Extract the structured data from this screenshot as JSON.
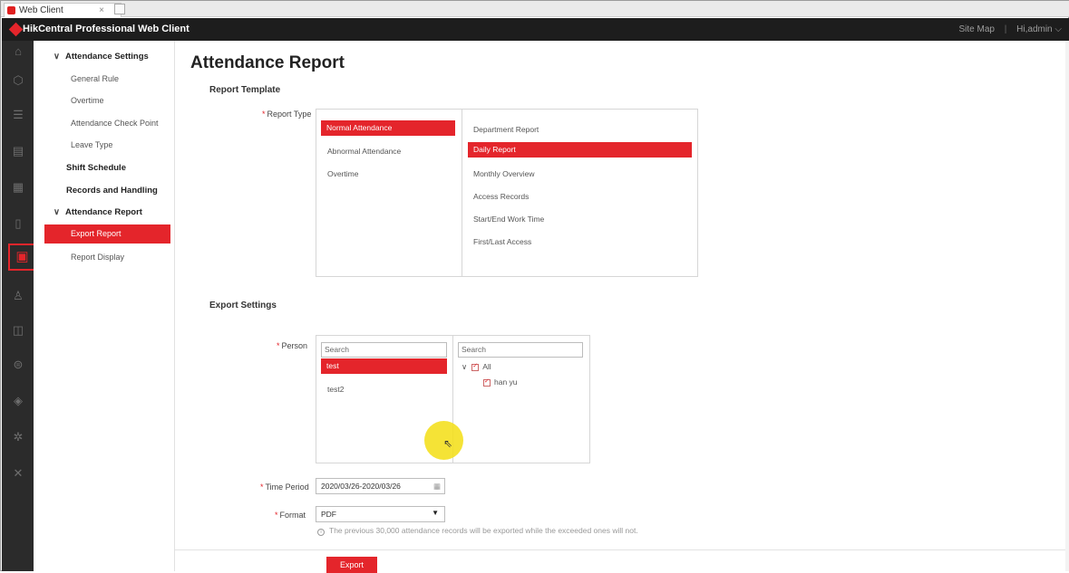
{
  "browser": {
    "tab_title": "Web Client",
    "close_glyph": "×"
  },
  "app": {
    "name": "HikCentral Professional Web Client",
    "site_map": "Site Map",
    "separator": "|",
    "user": "Hi,admin"
  },
  "rail_icons": [
    "home-icon",
    "cube-icon",
    "list-icon",
    "document-icon",
    "report-icon",
    "mobile-icon",
    "calendar-check-icon",
    "person-icon",
    "chart-icon",
    "vehicle-icon",
    "shield-icon",
    "settings-icon",
    "tools-icon"
  ],
  "nav": {
    "attendance_settings": "Attendance Settings",
    "general_rule": "General Rule",
    "overtime": "Overtime",
    "check_point": "Attendance Check Point",
    "leave_type": "Leave Type",
    "shift_schedule": "Shift Schedule",
    "records": "Records and Handling",
    "attendance_report": "Attendance Report",
    "export_report": "Export Report",
    "report_display": "Report Display"
  },
  "page": {
    "title": "Attendance Report",
    "report_template": "Report Template",
    "export_settings": "Export Settings"
  },
  "report_type": {
    "label": "Report Type",
    "left": [
      "Normal Attendance",
      "Abnormal Attendance",
      "Overtime"
    ],
    "right": [
      "Department Report",
      "Daily Report",
      "Monthly Overview",
      "Access Records",
      "Start/End Work Time",
      "First/Last Access"
    ],
    "selected_left": "Normal Attendance",
    "selected_right": "Daily Report"
  },
  "person": {
    "label": "Person",
    "left_search": "Search",
    "right_search": "Search",
    "left_items": [
      "test",
      "test2"
    ],
    "tree_all": "All",
    "tree_child": "han yu"
  },
  "time_period": {
    "label": "Time Period",
    "value": "2020/03/26-2020/03/26"
  },
  "format": {
    "label": "Format",
    "value": "PDF",
    "note": "The previous 30,000 attendance records will be exported while the exceeded ones will not."
  },
  "export_button": "Export",
  "required_mark": "*",
  "colors": {
    "accent": "#e4252b",
    "header": "#1d1d1d",
    "rail": "#2b2b2b"
  }
}
